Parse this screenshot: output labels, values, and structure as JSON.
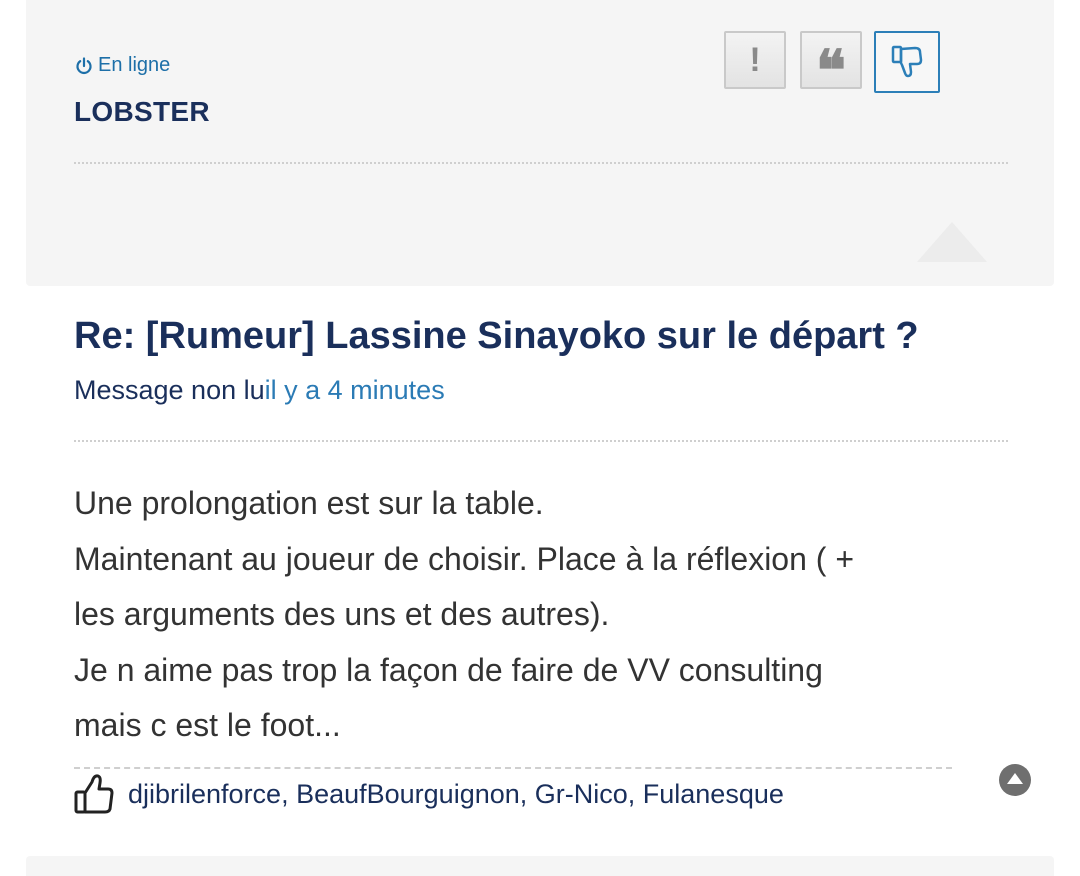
{
  "author": {
    "status_icon": "power-icon",
    "status": "En ligne",
    "username": "LOBSTER"
  },
  "toolbar": {
    "report_icon": "exclamation-icon",
    "report_glyph": "!",
    "quote_icon": "quote-icon",
    "quote_glyph": "❝",
    "dislike_icon": "thumbs-down-icon"
  },
  "post": {
    "title": "Re: [Rumeur] Lassine Sinayoko sur le départ ?",
    "unread_label": "Message non lu",
    "time": "il y a 4 minutes",
    "body_lines": [
      "Une prolongation est sur la table.",
      "Maintenant au joueur de choisir. Place à la réflexion ( +",
      "les arguments des uns et des autres).",
      "Je n aime pas trop la façon de faire de VV consulting",
      "mais c est le foot..."
    ]
  },
  "likes": {
    "icon": "thumbs-up-icon",
    "names": "djibrilenforce, BeaufBourguignon, Gr-Nico, Fulanesque"
  },
  "colors": {
    "navy": "#1a2f5b",
    "link_blue": "#2b7bb5",
    "active_border": "#2c7fb8"
  }
}
